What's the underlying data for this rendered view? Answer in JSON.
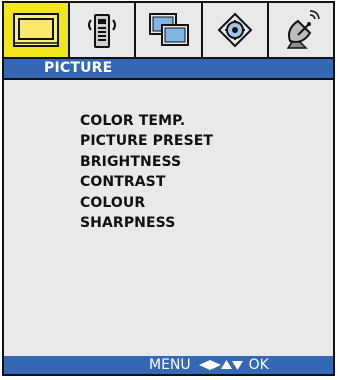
{
  "tabs": [
    {
      "id": "picture",
      "icon": "tv-monitor-icon",
      "active": true
    },
    {
      "id": "sound",
      "icon": "remote-speaker-icon",
      "active": false
    },
    {
      "id": "setup",
      "icon": "dual-screen-icon",
      "active": false
    },
    {
      "id": "features",
      "icon": "settings-diamond-icon",
      "active": false
    },
    {
      "id": "channel",
      "icon": "satellite-dish-icon",
      "active": false
    }
  ],
  "title": "PICTURE",
  "menu": {
    "items": [
      "COLOR TEMP.",
      "PICTURE PRESET",
      "BRIGHTNESS",
      "CONTRAST",
      "COLOUR",
      "SHARPNESS"
    ]
  },
  "footer": {
    "menu_label": "MENU",
    "ok_label": "OK"
  },
  "colors": {
    "accent_blue": "#3467b4",
    "active_tab_yellow": "#f1e51b",
    "panel_grey": "#e9e9e9",
    "text_dark": "#111111"
  }
}
